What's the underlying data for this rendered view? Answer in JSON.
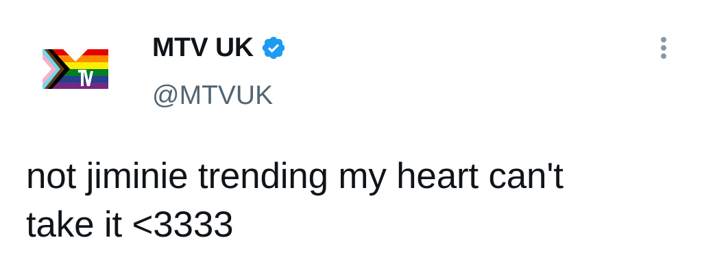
{
  "author": {
    "display_name": "MTV UK",
    "handle": "@MTVUK",
    "verified": true,
    "avatar_icon": "mtv-pride-logo-icon",
    "verified_icon": "verified-badge-icon",
    "colors": {
      "verified_blue": "#1d9bf0",
      "handle_gray": "#536471"
    }
  },
  "tweet": {
    "text_lines": [
      "not jiminie trending my heart can't",
      "take it <3333"
    ]
  },
  "actions": {
    "more_icon": "more-vertical-icon"
  }
}
